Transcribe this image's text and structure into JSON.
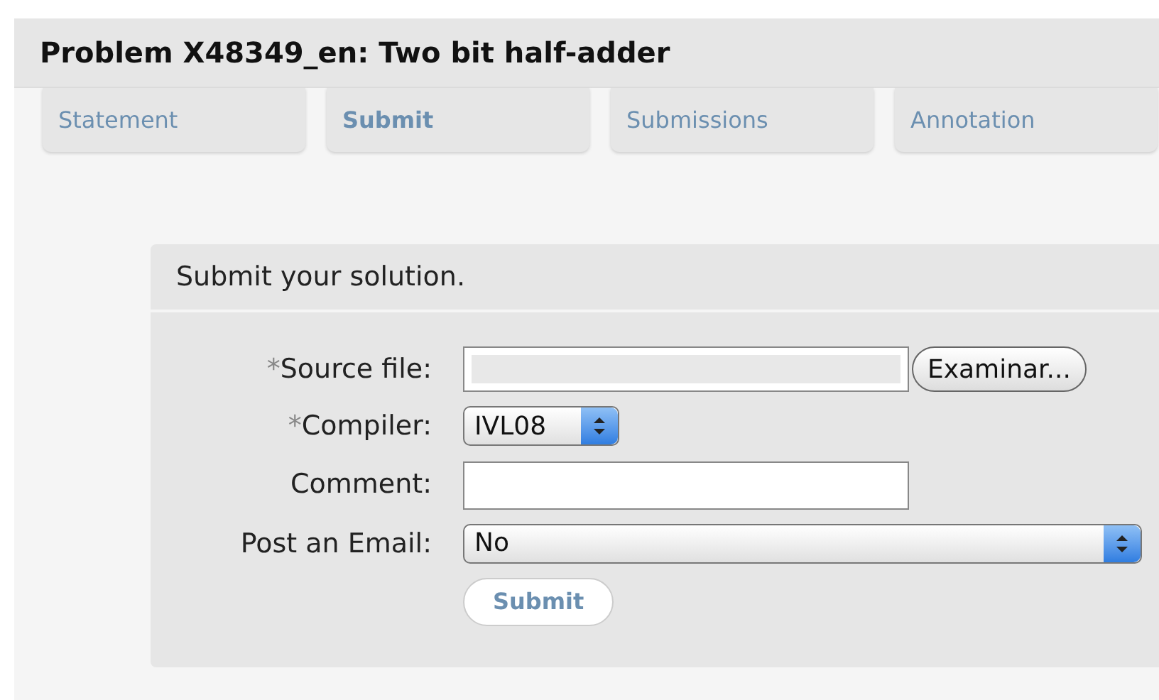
{
  "title": "Problem X48349_en: Two bit half-adder",
  "tabs": [
    {
      "label": "Statement",
      "selected": false
    },
    {
      "label": "Submit",
      "selected": true
    },
    {
      "label": "Submissions",
      "selected": false
    },
    {
      "label": "Annotation",
      "selected": false
    }
  ],
  "form": {
    "heading": "Submit your solution.",
    "fields": [
      {
        "kind": "file",
        "required": true,
        "required_mark": "*",
        "label": "Source file:",
        "button": "Examinar..."
      },
      {
        "kind": "select",
        "required": true,
        "required_mark": "*",
        "label": "Compiler:",
        "value": "IVL08",
        "wide": false
      },
      {
        "kind": "text",
        "required": false,
        "label": "Comment:"
      },
      {
        "kind": "select",
        "required": false,
        "label": "Post an Email:",
        "value": "No",
        "wide": true
      }
    ],
    "submit": "Submit"
  }
}
